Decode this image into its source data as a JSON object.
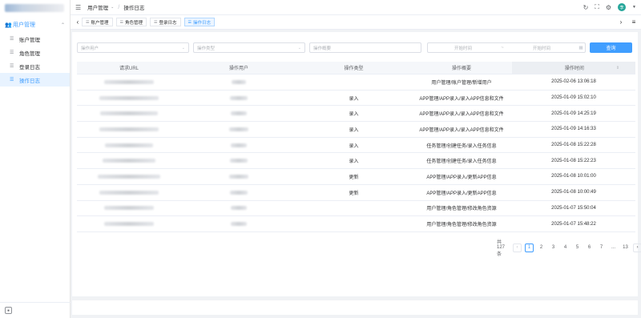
{
  "sidebar": {
    "group_label": "用户管理",
    "items": [
      {
        "label": "账户管理"
      },
      {
        "label": "角色管理"
      },
      {
        "label": "登录日志"
      },
      {
        "label": "操作日志"
      }
    ]
  },
  "header": {
    "breadcrumb": [
      "用户管理",
      "操作日志"
    ]
  },
  "user": {
    "avatar_text": "李"
  },
  "tags": [
    "账户管理",
    "角色管理",
    "登录日志",
    "操作日志"
  ],
  "filters": {
    "user_placeholder": "操作用户",
    "type_placeholder": "操作类型",
    "summary_placeholder": "操作概要",
    "start_placeholder": "开始时间",
    "range_sep": "~",
    "end_placeholder": "开始时间",
    "query_label": "查询"
  },
  "table": {
    "headers": [
      "请求URL",
      "操作用户",
      "操作类型",
      "操作概要",
      "操作时间"
    ],
    "rows": [
      {
        "type": "",
        "summary": "用户管理/账户管理/新增用户",
        "time": "2025-02-06 13:06:18"
      },
      {
        "type": "录入",
        "summary": "APP管理/APP录入/录入APP信息和文件",
        "time": "2025-01-09 15:02:10"
      },
      {
        "type": "录入",
        "summary": "APP管理/APP录入/录入APP信息和文件",
        "time": "2025-01-09 14:25:19"
      },
      {
        "type": "录入",
        "summary": "APP管理/APP录入/录入APP信息和文件",
        "time": "2025-01-09 14:16:33"
      },
      {
        "type": "录入",
        "summary": "任务管理/创建任务/录入任务信息",
        "time": "2025-01-08 15:22:28"
      },
      {
        "type": "录入",
        "summary": "任务管理/创建任务/录入任务信息",
        "time": "2025-01-08 15:22:23"
      },
      {
        "type": "更新",
        "summary": "APP管理/APP录入/更新APP信息",
        "time": "2025-01-08 10:01:00"
      },
      {
        "type": "更新",
        "summary": "APP管理/APP录入/更新APP信息",
        "time": "2025-01-08 10:00:49"
      },
      {
        "type": "",
        "summary": "用户管理/角色管理/修改角色资源",
        "time": "2025-01-07 15:50:04"
      },
      {
        "type": "",
        "summary": "用户管理/角色管理/修改角色资源",
        "time": "2025-01-07 15:48:22"
      }
    ]
  },
  "pagination": {
    "total_text": "共 127 条",
    "pages": [
      "1",
      "2",
      "3",
      "4",
      "5",
      "6",
      "7",
      "...",
      "13"
    ],
    "current": "1"
  }
}
